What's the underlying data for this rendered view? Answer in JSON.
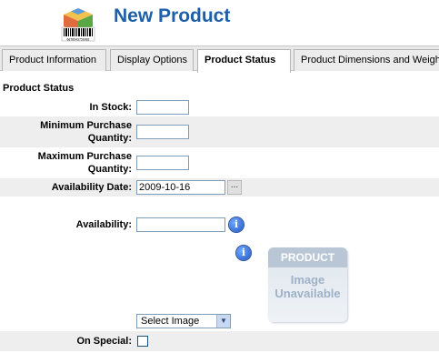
{
  "header": {
    "title": "New Product",
    "logo_icon": "product-box-barcode-icon",
    "barcode_digits": "6078943756903"
  },
  "tabs": [
    {
      "label": "Product Information",
      "active": false
    },
    {
      "label": "Display Options",
      "active": false
    },
    {
      "label": "Product Status",
      "active": true
    },
    {
      "label": "Product Dimensions and Weight",
      "active": false
    }
  ],
  "section": {
    "title": "Product Status"
  },
  "fields": {
    "in_stock": {
      "label": "In Stock:",
      "value": ""
    },
    "min_qty": {
      "label_line1": "Minimum Purchase",
      "label_line2": "Quantity:",
      "value": ""
    },
    "max_qty": {
      "label_line1": "Maximum Purchase",
      "label_line2": "Quantity:",
      "value": ""
    },
    "availability_date": {
      "label": "Availability Date:",
      "value": "2009-10-16",
      "picker_label": "..."
    },
    "availability": {
      "label": "Availability:",
      "value": ""
    },
    "image": {
      "placeholder_band": "PRODUCT",
      "placeholder_line1": "Image",
      "placeholder_line2": "Unavailable",
      "select_value": "Select Image"
    },
    "on_special": {
      "label": "On Special:",
      "checked": false
    }
  },
  "icons": {
    "info": "info-icon",
    "info_glyph": "i"
  },
  "colors": {
    "title": "#1d5fa8",
    "shade_row": "#eeeeee",
    "info_blue": "#1f57c3"
  }
}
